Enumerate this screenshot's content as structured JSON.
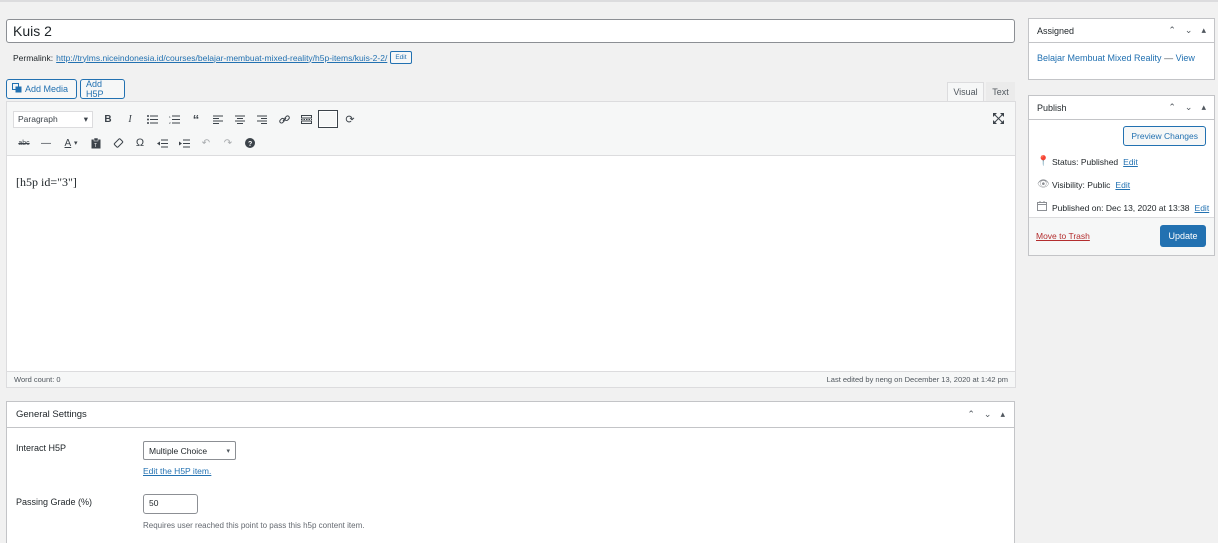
{
  "post": {
    "title": "Kuis 2",
    "permalink_label": "Permalink:",
    "permalink_url": "http://trylms.niceindonesia.id/courses/belajar-membuat-mixed-reality/h5p-items/kuis-2-2/",
    "permalink_edit": "Edit"
  },
  "media_buttons": {
    "add_media": "Add Media",
    "add_h5p": "Add H5P"
  },
  "editor_tabs": {
    "visual": "Visual",
    "text": "Text"
  },
  "toolbar": {
    "format_value": "Paragraph",
    "icons_row1": [
      "bold-icon",
      "italic-icon",
      "bulleted-list-icon",
      "numbered-list-icon",
      "blockquote-icon",
      "align-left-icon",
      "align-center-icon",
      "align-right-icon",
      "link-icon",
      "read-more-icon",
      "toolbar-toggle-icon",
      "sync-icon"
    ],
    "icons_row2": [
      "strikethrough-icon",
      "horizontal-line-icon",
      "text-color-icon",
      "paste-text-icon",
      "clear-formatting-icon",
      "special-character-icon",
      "outdent-icon",
      "indent-icon",
      "undo-icon",
      "redo-icon",
      "help-icon"
    ]
  },
  "editor": {
    "content": "[h5p id=\"3\"]",
    "word_count": "Word count: 0",
    "last_edited": "Last edited by neng on December 13, 2020 at 1:42 pm"
  },
  "settings": {
    "title": "General Settings",
    "interact_label": "Interact H5P",
    "interact_value": "Multiple Choice",
    "edit_link": "Edit the H5P item.",
    "passing_label": "Passing Grade (%)",
    "passing_value": "50",
    "passing_help": "Requires user reached this point to pass this h5p content item."
  },
  "assigned": {
    "title": "Assigned",
    "course_link": "Belajar Membuat Mixed Reality",
    "separator": " — ",
    "view_link": "View"
  },
  "publish": {
    "title": "Publish",
    "preview": "Preview Changes",
    "status_label": "Status: Published",
    "visibility_label": "Visibility: Public",
    "published_label": "Published on: Dec 13, 2020 at 13:38",
    "edit": "Edit",
    "trash": "Move to Trash",
    "update": "Update"
  },
  "colors": {
    "accent": "#2271b1",
    "danger": "#b32d2e",
    "background": "#f1f1f1"
  }
}
